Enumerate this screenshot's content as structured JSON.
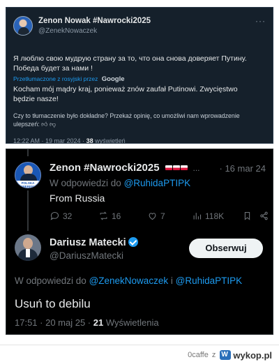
{
  "tweet1": {
    "display_name": "Zenon Nowak #Nawrocki2025",
    "handle": "@ZenekNowaczek",
    "more_icon": "more-dots-icon",
    "text_ru_line1": "Я люблю свою мудрую страну за то, что она снова доверяет Путину.",
    "text_ru_line2": "Победа будет за нами !",
    "translated_label": "Przetłumaczone z rosyjski przez",
    "translator": "Google",
    "text_pl_line1": "Kocham mój mądry kraj, ponieważ znów zaufał Putinowi. Zwycięstwo",
    "text_pl_line2": "będzie nasze!",
    "feedback_line1": "Czy to tłumaczenie było dokładne? Przekaż opinię, co umożliwi nam wprowadzenie",
    "feedback_line2": "ulepszeń:",
    "timestamp": "12:22 AM · 19 mar 2024 ·",
    "views_count": "38",
    "views_label": "wyświetleń"
  },
  "tweet2": {
    "display_name": "Zenon #Nawrocki2025",
    "name_suffix": "...",
    "date": "· 16 mar 24",
    "avatar_label": "POLSKA SUWERENNA SPRAWA",
    "reply_prefix": "W odpowiedzi do",
    "reply_mention": "@RuhidaPTIPK",
    "text": "From Russia",
    "actions": {
      "replies": "32",
      "retweets": "16",
      "likes": "7",
      "views": "118K"
    }
  },
  "tweet3": {
    "display_name": "Dariusz Matecki",
    "handle": "@DariuszMatecki",
    "follow_label": "Obserwuj",
    "reply_prefix": "W odpowiedzi do",
    "reply_mention1": "@ZenekNowaczek",
    "reply_join": "i",
    "reply_mention2": "@RuhidaPTIPK",
    "text": "Usuń to debilu",
    "timestamp": "17:51 · 20 maj 25 ·",
    "views_count": "21",
    "views_label": "Wyświetlenia"
  },
  "footer": {
    "username": "0caffe",
    "preposition": "z",
    "brand": "wykop.pl"
  },
  "colors": {
    "dim_bg": "#15202b",
    "black_bg": "#000000",
    "accent_blue": "#1d9bf0",
    "muted_text": "#71767b"
  }
}
